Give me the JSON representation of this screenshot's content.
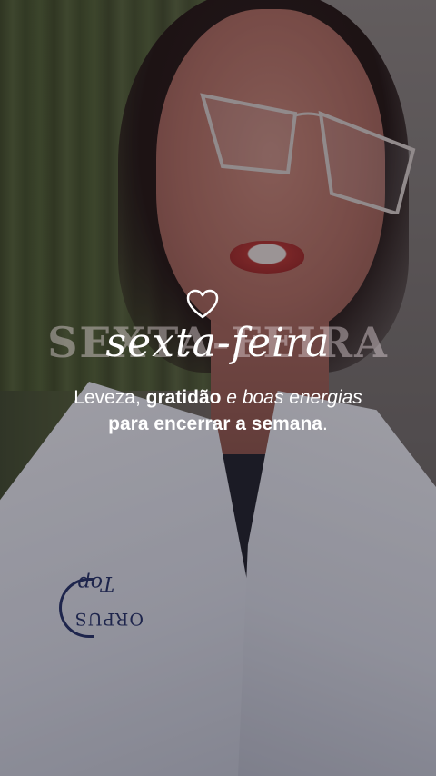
{
  "story": {
    "title_background": "SEXTA-FEIRA",
    "title_script": "sexta-feira",
    "line1": {
      "part1": "Leveza, ",
      "part2": "gratidão",
      "part3": " e ",
      "part4": "boas energias"
    },
    "line2": {
      "main": "para encerrar a semana",
      "end": "."
    }
  },
  "embroidery": {
    "top": "Top",
    "bottom": "ORPUS"
  },
  "icons": {
    "heart": "heart-outline-icon"
  },
  "colors": {
    "text": "#ffffff",
    "overlay": "#1e161c",
    "embroidery": "#1f2f6a"
  }
}
